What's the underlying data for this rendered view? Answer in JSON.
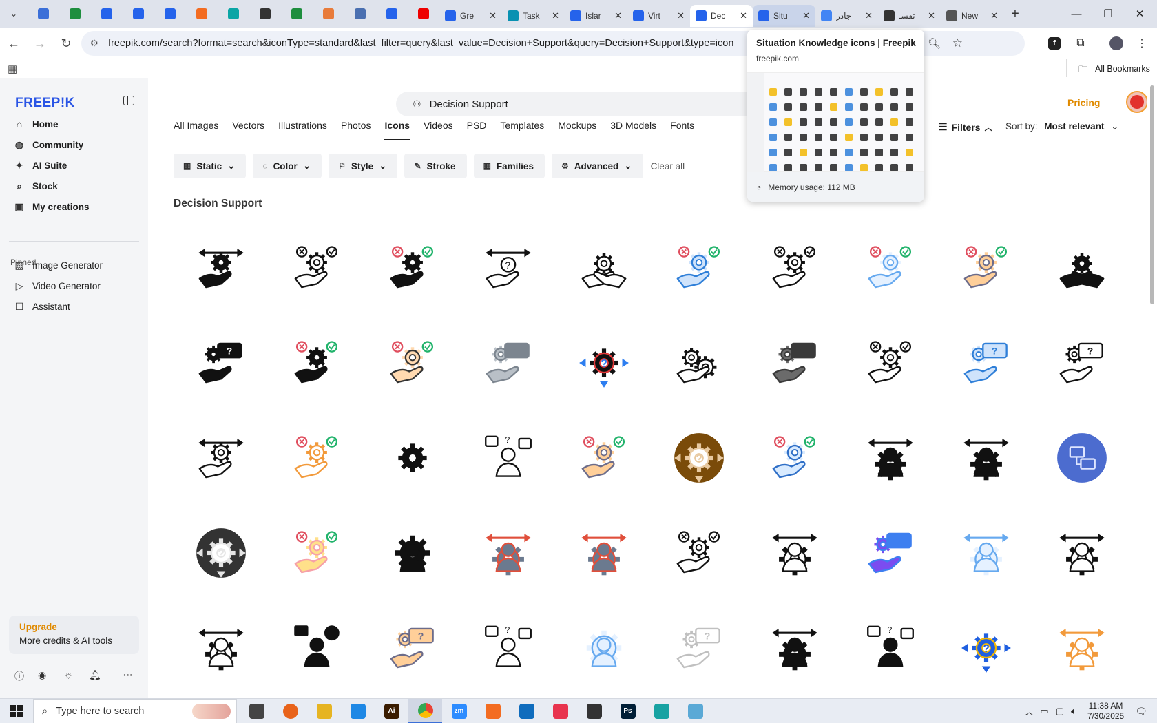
{
  "browser": {
    "tabs": [
      {
        "title": "Gre",
        "favicon_color": "#2563eb"
      },
      {
        "title": "Task",
        "favicon_color": "#0891b2"
      },
      {
        "title": "Islar",
        "favicon_color": "#2563eb"
      },
      {
        "title": "Virt",
        "favicon_color": "#2563eb"
      },
      {
        "title": "Dec",
        "favicon_color": "#2563eb"
      },
      {
        "title": "Situ",
        "favicon_color": "#2563eb"
      },
      {
        "title": "جادر",
        "favicon_color": "#4285f4"
      },
      {
        "title": "تفسـ",
        "favicon_color": "#333333"
      },
      {
        "title": "New",
        "favicon_color": "#555555"
      }
    ],
    "url": "freepik.com/search?format=search&iconType=standard&last_filter=query&last_value=Decision+Support&query=Decision+Support&type=icon",
    "bookmarks_label": "All Bookmarks"
  },
  "hovercard": {
    "title": "Situation Knowledge icons | Freepik",
    "domain": "freepik.com",
    "memory": "Memory usage: 112 MB"
  },
  "sidebar": {
    "logo": "FREEP!K",
    "nav": [
      {
        "label": "Home",
        "icon": "home-icon"
      },
      {
        "label": "Community",
        "icon": "globe-icon"
      },
      {
        "label": "AI Suite",
        "icon": "sparkle-icon"
      },
      {
        "label": "Stock",
        "icon": "search-icon"
      },
      {
        "label": "My creations",
        "icon": "folder-icon"
      }
    ],
    "pinned_heading": "Pinned",
    "pinned": [
      {
        "label": "Image Generator",
        "icon": "image-icon"
      },
      {
        "label": "Video Generator",
        "icon": "video-icon"
      },
      {
        "label": "Assistant",
        "icon": "chat-icon"
      }
    ],
    "upgrade_title": "Upgrade",
    "upgrade_sub": "More credits & AI tools"
  },
  "header": {
    "search_value": "Decision Support",
    "pricing": "Pricing"
  },
  "content_tabs": [
    "All Images",
    "Vectors",
    "Illustrations",
    "Photos",
    "Icons",
    "Videos",
    "PSD",
    "Templates",
    "Mockups",
    "3D Models",
    "Fonts"
  ],
  "active_tab": "Icons",
  "filters_label": "Filters",
  "sort_label": "Sort by:",
  "sort_value": "Most relevant",
  "chips": [
    "Static",
    "Color",
    "Style",
    "Stroke",
    "Families",
    "Advanced"
  ],
  "clear_all": "Clear all",
  "results_title": "Decision Support",
  "icons": [
    {
      "style": "solid-black",
      "motif": "hand-gear-arrows"
    },
    {
      "style": "outline-black",
      "motif": "hand-gear-choices"
    },
    {
      "style": "solid-black",
      "motif": "hand-gear-choices"
    },
    {
      "style": "outline-black",
      "motif": "hand-question-arrows"
    },
    {
      "style": "outline-black",
      "motif": "hands-gear-arrows"
    },
    {
      "style": "blue",
      "motif": "hand-gear-choices"
    },
    {
      "style": "outline-black",
      "motif": "hand-gear-choices"
    },
    {
      "style": "light-blue",
      "motif": "hand-gear-choices"
    },
    {
      "style": "multicolor",
      "motif": "hand-gear-choices"
    },
    {
      "style": "solid-black",
      "motif": "hands-gear"
    },
    {
      "style": "solid-black",
      "motif": "hand-gear-chat"
    },
    {
      "style": "solid-black",
      "motif": "hand-gear-choices"
    },
    {
      "style": "multicolor-outline",
      "motif": "hand-gear-choices"
    },
    {
      "style": "gray",
      "motif": "hand-gear-chat"
    },
    {
      "style": "red-blue",
      "motif": "gear-question-arrows"
    },
    {
      "style": "outline-black",
      "motif": "gears-check"
    },
    {
      "style": "gray-dark",
      "motif": "hand-gear-chat"
    },
    {
      "style": "outline-black",
      "motif": "hand-gear-choices"
    },
    {
      "style": "blue",
      "motif": "hand-gear-chat"
    },
    {
      "style": "outline-black",
      "motif": "hand-gear-chat"
    },
    {
      "style": "outline-black",
      "motif": "hand-gear-arrows"
    },
    {
      "style": "orange",
      "motif": "hand-gear-choices"
    },
    {
      "style": "solid-black",
      "motif": "gear-question-arrows"
    },
    {
      "style": "outline-black",
      "motif": "person-question"
    },
    {
      "style": "multicolor",
      "motif": "hand-gear-choices"
    },
    {
      "style": "brown-circle",
      "motif": "gear-question-arrows"
    },
    {
      "style": "blue-outline",
      "motif": "hand-gear-choices"
    },
    {
      "style": "solid-black",
      "motif": "person-arrows"
    },
    {
      "style": "solid-black",
      "motif": "person-arrows"
    },
    {
      "style": "blue-circle",
      "motif": "network"
    },
    {
      "style": "dark-circle",
      "motif": "gear-question-arrows"
    },
    {
      "style": "pastel",
      "motif": "hand-gear-choices"
    },
    {
      "style": "solid-black",
      "motif": "person-gear"
    },
    {
      "style": "red-gray",
      "motif": "person-arrows"
    },
    {
      "style": "red-gray",
      "motif": "person-arrows"
    },
    {
      "style": "outline-black",
      "motif": "hand-gear-choices"
    },
    {
      "style": "outline-black",
      "motif": "person-arrows"
    },
    {
      "style": "purple-blue",
      "motif": "hand-gear-chat"
    },
    {
      "style": "light-blue",
      "motif": "person-arrows"
    },
    {
      "style": "outline-black",
      "motif": "person-arrows"
    },
    {
      "style": "outline-black",
      "motif": "person-arrows"
    },
    {
      "style": "solid-black",
      "motif": "person-choices"
    },
    {
      "style": "multicolor",
      "motif": "hand-gear-chat"
    },
    {
      "style": "outline-black",
      "motif": "person-question"
    },
    {
      "style": "light-blue",
      "motif": "person-gear"
    },
    {
      "style": "light-gray",
      "motif": "hand-gear-chat"
    },
    {
      "style": "solid-black",
      "motif": "person-arrows"
    },
    {
      "style": "solid-black",
      "motif": "person-question"
    },
    {
      "style": "blue-yellow",
      "motif": "gear-question-arrows"
    },
    {
      "style": "orange",
      "motif": "person-arrows"
    }
  ],
  "taskbar": {
    "search_placeholder": "Type here to search",
    "time": "11:38 AM",
    "date": "7/30/2025",
    "apps": [
      {
        "name": "task-view",
        "color": "#444444",
        "label": ""
      },
      {
        "name": "firefox",
        "color": "#e8631a",
        "label": ""
      },
      {
        "name": "file-explorer",
        "color": "#e6b422",
        "label": ""
      },
      {
        "name": "vscode",
        "color": "#1e88e5",
        "label": ""
      },
      {
        "name": "illustrator",
        "color": "#3a1c00",
        "label": "Ai"
      },
      {
        "name": "chrome",
        "color": "#4285f4",
        "label": ""
      },
      {
        "name": "zoom",
        "color": "#2d8cff",
        "label": "zm"
      },
      {
        "name": "xampp",
        "color": "#f36c21",
        "label": ""
      },
      {
        "name": "outlook",
        "color": "#0f6cbd",
        "label": ""
      },
      {
        "name": "creative-cloud",
        "color": "#e8344e",
        "label": ""
      },
      {
        "name": "pen-tool",
        "color": "#333333",
        "label": ""
      },
      {
        "name": "photoshop",
        "color": "#001e36",
        "label": "Ps"
      },
      {
        "name": "app-teal",
        "color": "#17a2a2",
        "label": ""
      },
      {
        "name": "app-notepad",
        "color": "#5aa9d6",
        "label": ""
      }
    ]
  }
}
